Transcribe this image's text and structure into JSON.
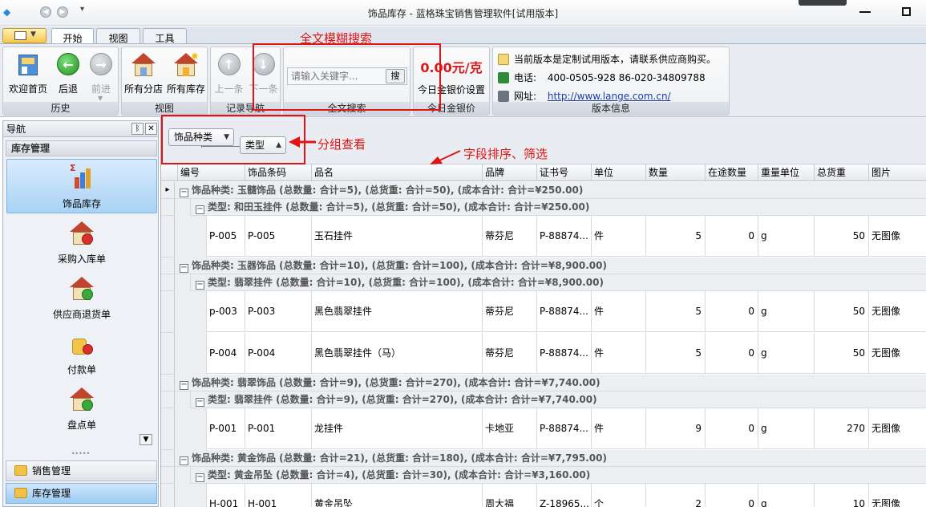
{
  "window": {
    "title": "饰品库存 - 蓝格珠宝销售管理软件[试用版本]"
  },
  "ribbon_tabs": [
    "开始",
    "视图",
    "工具"
  ],
  "ribbon": {
    "history": {
      "label": "历史",
      "buttons": [
        "欢迎首页",
        "后退",
        "前进"
      ]
    },
    "view": {
      "label": "视图",
      "buttons": [
        "所有分店",
        "所有库存"
      ]
    },
    "record_nav": {
      "label": "记录导航",
      "buttons": [
        "上一条",
        "下一条"
      ]
    },
    "search": {
      "label": "全文搜索",
      "placeholder": "请输入关键字...",
      "button": "搜"
    },
    "gold_price": {
      "label": "今日金银价",
      "value": "0.00元/克",
      "button": "今日金银价设置"
    },
    "version": {
      "label": "版本信息",
      "notice": "当前版本是定制试用版本，请联系供应商购买。",
      "phone_label": "电话:",
      "phone": "400-0505-928  86-020-34809788",
      "web_label": "网址:",
      "web": "http://www.lange.com.cn/"
    }
  },
  "annotations": {
    "search": "全文模糊搜索",
    "group": "分组查看",
    "sort": "字段排序、筛选"
  },
  "nav": {
    "title": "导航",
    "section": "库存管理",
    "items": [
      "饰品库存",
      "采购入库单",
      "供应商退货单",
      "付款单",
      "盘点单"
    ],
    "categories": [
      "销售管理",
      "库存管理"
    ]
  },
  "groupby": {
    "chips": [
      "饰品种类",
      "类型"
    ]
  },
  "grid": {
    "columns": [
      "编号",
      "饰品条码",
      "品名",
      "品牌",
      "证书号",
      "单位",
      "数量",
      "在途数量",
      "重量单位",
      "总货重",
      "图片"
    ],
    "rows": [
      {
        "kind": "g1",
        "text": "饰品种类: 玉髓饰品 (总数量: 合计=5), (总货重: 合计=50), (成本合计: 合计=¥250.00)"
      },
      {
        "kind": "g2",
        "text": "类型: 和田玉挂件 (总数量: 合计=5), (总货重: 合计=50), (成本合计: 合计=¥250.00)"
      },
      {
        "kind": "data",
        "cells": [
          "P-005",
          "P-005",
          "玉石挂件",
          "蒂芬尼",
          "P-88874...",
          "件",
          "5",
          "0",
          "g",
          "50",
          "无图像"
        ]
      },
      {
        "kind": "g1",
        "text": "饰品种类: 玉器饰品 (总数量: 合计=10), (总货重: 合计=100), (成本合计: 合计=¥8,900.00)"
      },
      {
        "kind": "g2",
        "text": "类型: 翡翠挂件 (总数量: 合计=10), (总货重: 合计=100), (成本合计: 合计=¥8,900.00)"
      },
      {
        "kind": "data",
        "cells": [
          "p-003",
          "P-003",
          "黑色翡翠挂件",
          "蒂芬尼",
          "P-88874...",
          "件",
          "5",
          "0",
          "g",
          "50",
          "无图像"
        ]
      },
      {
        "kind": "data",
        "cells": [
          "P-004",
          "P-004",
          "黑色翡翠挂件（马）",
          "蒂芬尼",
          "P-88874...",
          "件",
          "5",
          "0",
          "g",
          "50",
          "无图像"
        ]
      },
      {
        "kind": "g1",
        "text": "饰品种类: 翡翠饰品 (总数量: 合计=9), (总货重: 合计=270), (成本合计: 合计=¥7,740.00)"
      },
      {
        "kind": "g2",
        "text": "类型: 翡翠挂件 (总数量: 合计=9), (总货重: 合计=270), (成本合计: 合计=¥7,740.00)"
      },
      {
        "kind": "data",
        "cells": [
          "P-001",
          "P-001",
          "龙挂件",
          "卡地亚",
          "P-88874...",
          "件",
          "9",
          "0",
          "g",
          "270",
          "无图像"
        ]
      },
      {
        "kind": "g1",
        "text": "饰品种类: 黄金饰品 (总数量: 合计=21), (总货重: 合计=180), (成本合计: 合计=¥7,795.00)"
      },
      {
        "kind": "g2",
        "text": "类型: 黄金吊坠 (总数量: 合计=4), (总货重: 合计=30), (成本合计: 合计=¥3,160.00)"
      },
      {
        "kind": "data",
        "cells": [
          "H-001",
          "H-001",
          "黄金吊坠",
          "周大福",
          "Z-18965...",
          "个",
          "2",
          "0",
          "g",
          "10",
          "无图像"
        ]
      }
    ]
  }
}
